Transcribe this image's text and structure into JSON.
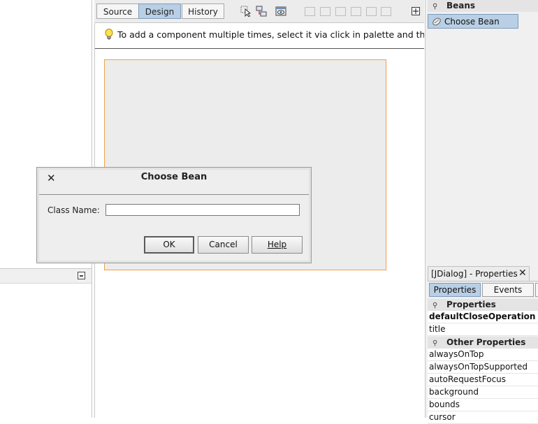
{
  "editor": {
    "tabs": [
      {
        "label": "Source"
      },
      {
        "label": "Design"
      },
      {
        "label": "History"
      }
    ],
    "hint": "To add a component multiple times, select it via click in palette and then Shift+click in the form"
  },
  "dialog": {
    "title": "Choose Bean",
    "class_name_label": "Class Name:",
    "class_name_value": "",
    "ok_label": "OK",
    "cancel_label": "Cancel",
    "help_label": "Help"
  },
  "palette": {
    "category": "Beans",
    "items": [
      {
        "label": "Choose Bean"
      }
    ]
  },
  "properties": {
    "window_title": "[JDialog] - Properties",
    "tabs": [
      {
        "label": "Properties"
      },
      {
        "label": "Events"
      }
    ],
    "sections": [
      {
        "title": "Properties",
        "rows": [
          {
            "name": "defaultCloseOperation",
            "bold": true
          },
          {
            "name": "title",
            "bold": false
          }
        ]
      },
      {
        "title": "Other Properties",
        "rows": [
          {
            "name": "alwaysOnTop"
          },
          {
            "name": "alwaysOnTopSupported"
          },
          {
            "name": "autoRequestFocus"
          },
          {
            "name": "background"
          },
          {
            "name": "bounds"
          },
          {
            "name": "cursor"
          }
        ]
      }
    ]
  },
  "colors": {
    "selection": "#b8cfe5",
    "frame_border": "#f0a04b"
  }
}
